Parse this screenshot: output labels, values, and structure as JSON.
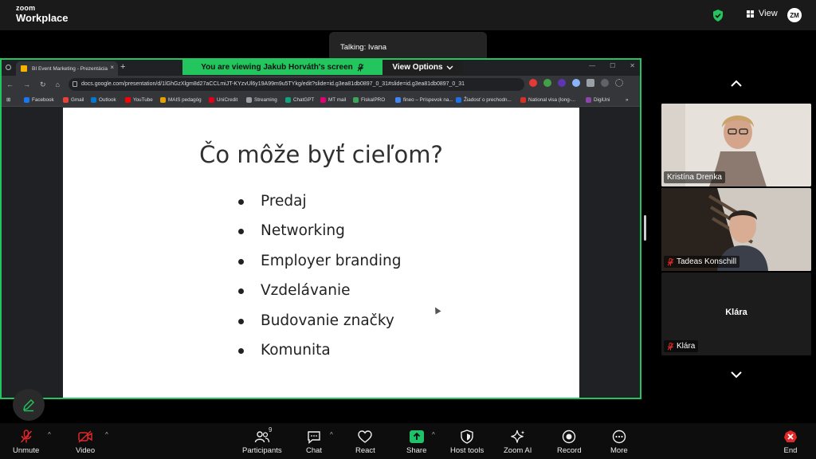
{
  "app": {
    "brand_line1": "zoom",
    "brand_line2": "Workplace",
    "view_label": "View",
    "avatar_initials": "ZM"
  },
  "talking": {
    "text": "Talking: Ivana"
  },
  "share_banner": {
    "viewing_text": "You are viewing  Jakub Horváth's screen",
    "view_options_label": "View Options"
  },
  "browser": {
    "tab_title": "BI Event Marketing - Prezentácia",
    "url": "docs.google.com/presentation/d/1lGhGzXlgm8d27aCCLmiJT-KYzvUl6y19A99m9u5TYkg/edit?slide=id.g3ea81db0897_0_31#slide=id.g3ea81db0897_0_31",
    "bookmarks": [
      {
        "label": "Facebook",
        "color": "#1877f2"
      },
      {
        "label": "Gmail",
        "color": "#ea4335"
      },
      {
        "label": "Outlook",
        "color": "#0078d4"
      },
      {
        "label": "YouTube",
        "color": "#ff0000"
      },
      {
        "label": "MAIS pedagóg",
        "color": "#e6a100"
      },
      {
        "label": "UniCredit",
        "color": "#e2001a"
      },
      {
        "label": "Streaming",
        "color": "#9aa0a6"
      },
      {
        "label": "ChatGPT",
        "color": "#10a37f"
      },
      {
        "label": "MT mail",
        "color": "#e20074"
      },
      {
        "label": "FiskalPRO",
        "color": "#3ba55c"
      },
      {
        "label": "fineo – Príspevok na...",
        "color": "#4285f4"
      },
      {
        "label": "Žiadosť o prechodn...",
        "color": "#1a73e8"
      },
      {
        "label": "National visa (long-...",
        "color": "#d93025"
      },
      {
        "label": "DigiUni",
        "color": "#8e44ad"
      }
    ]
  },
  "slide": {
    "title": "Čo môže byť cieľom?",
    "bullets": [
      "Predaj",
      "Networking",
      "Employer branding",
      "Vzdelávanie",
      "Budovanie značky",
      "Komunita"
    ]
  },
  "participants": {
    "tiles": [
      {
        "name": "Kristína Drenka",
        "muted": false
      },
      {
        "name": "Tadeas Konschill",
        "muted": true
      },
      {
        "name": "Klára",
        "muted": true
      }
    ]
  },
  "toolbar": {
    "unmute": "Unmute",
    "video": "Video",
    "participants": "Participants",
    "participants_count": "9",
    "chat": "Chat",
    "react": "React",
    "share": "Share",
    "host_tools": "Host tools",
    "zoom_ai": "Zoom AI",
    "record": "Record",
    "more": "More",
    "end": "End"
  },
  "colors": {
    "accent_green": "#22c55e",
    "end_red": "#e02828",
    "share_green": "#1fc26b"
  }
}
